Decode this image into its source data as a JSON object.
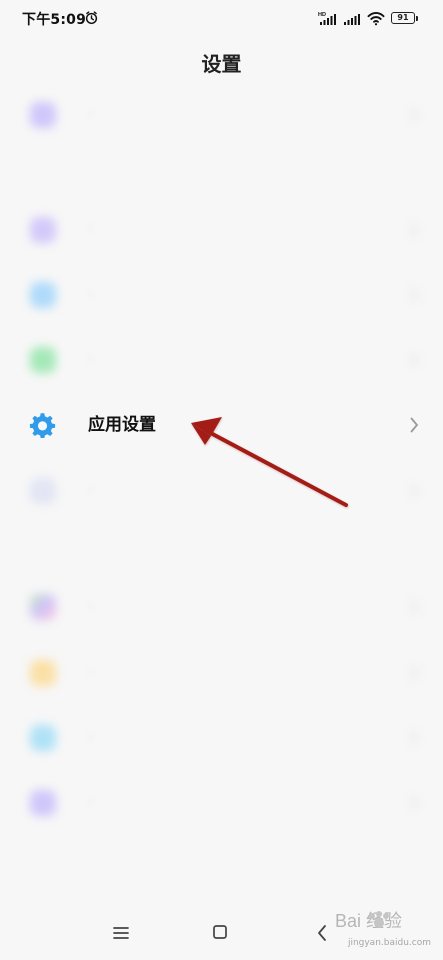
{
  "status_bar": {
    "time": "下午5:09",
    "hd_label": "HD",
    "battery_level": "91"
  },
  "header": {
    "title": "设置"
  },
  "colors": {
    "accent_gear": "#2F9BEA",
    "annotation_arrow": "#A41C18",
    "page_background": "#F7F7F7"
  },
  "items": [
    {
      "icon": "purple-rounded-icon",
      "label": "·",
      "blurred": true
    },
    {
      "icon": "purple-rounded-icon",
      "label": "·",
      "blurred": true
    },
    {
      "icon": "blue-rounded-icon",
      "label": "·",
      "blurred": true
    },
    {
      "icon": "green-rounded-icon",
      "label": "·",
      "blurred": true
    },
    {
      "icon": "gear-icon",
      "label": "应用设置",
      "blurred": false
    },
    {
      "icon": "gray-rounded-icon",
      "label": "·",
      "blurred": true
    },
    {
      "icon": "colorful-rounded-icon",
      "label": "·",
      "blurred": true
    },
    {
      "icon": "orange-rounded-icon",
      "label": "·",
      "blurred": true
    },
    {
      "icon": "cyan-rounded-icon",
      "label": "·",
      "blurred": true
    },
    {
      "icon": "violet-rounded-icon",
      "label": "·",
      "blurred": true
    }
  ],
  "nav": {
    "menu": "menu-icon",
    "home": "home-icon",
    "back": "back-icon"
  },
  "watermark": {
    "text": "Bai 经验",
    "domain": "jingyan.baidu.com"
  }
}
